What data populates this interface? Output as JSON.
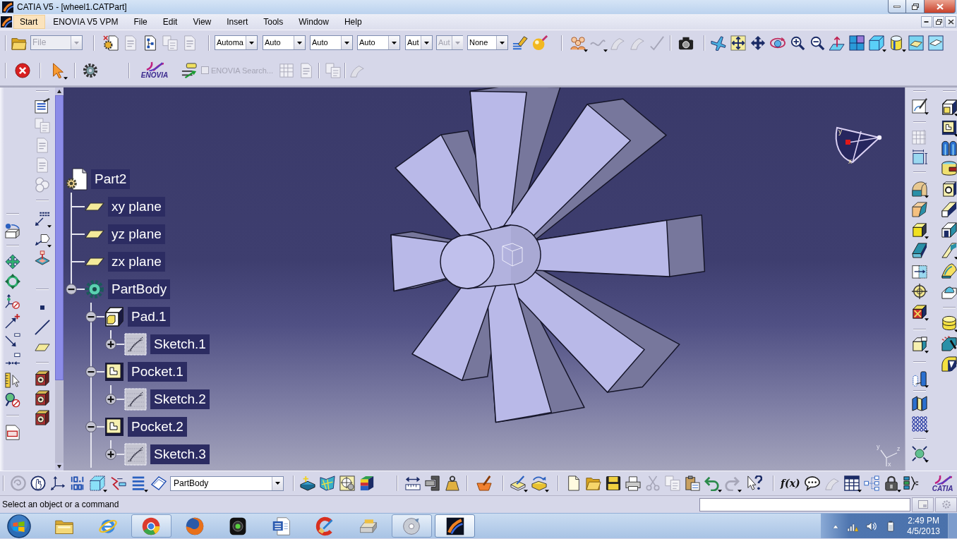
{
  "window": {
    "title": "CATIA V5 - [wheel1.CATPart]"
  },
  "menu_bar": {
    "items": [
      {
        "label": "Start",
        "selected": true
      },
      {
        "label": "ENOVIA V5 VPM",
        "selected": false
      },
      {
        "label": "File",
        "selected": false
      },
      {
        "label": "Edit",
        "selected": false
      },
      {
        "label": "View",
        "selected": false
      },
      {
        "label": "Insert",
        "selected": false
      },
      {
        "label": "Tools",
        "selected": false
      },
      {
        "label": "Window",
        "selected": false
      },
      {
        "label": "Help",
        "selected": false
      }
    ]
  },
  "standard_toolbar": {
    "file_combo": {
      "value": "File",
      "disabled": true
    }
  },
  "graphic_properties": {
    "combos": [
      {
        "value": "Automa",
        "disabled": false
      },
      {
        "value": "Auto",
        "disabled": false
      },
      {
        "value": "Auto",
        "disabled": false
      },
      {
        "value": "Auto",
        "disabled": false
      },
      {
        "value": "Aut",
        "disabled": false
      },
      {
        "value": "Aut",
        "disabled": true
      },
      {
        "value": "None",
        "disabled": false
      }
    ]
  },
  "enovia_toolbar": {
    "logo": "ENOVIA",
    "search": {
      "label": "ENOVIA Search...",
      "checked": false,
      "disabled": true
    }
  },
  "spec_tree": {
    "root": {
      "label": "Part2",
      "kind": "part",
      "children": [
        {
          "label": "xy plane",
          "kind": "plane"
        },
        {
          "label": "yz plane",
          "kind": "plane"
        },
        {
          "label": "zx plane",
          "kind": "plane"
        },
        {
          "label": "PartBody",
          "kind": "body",
          "expanded": true,
          "children": [
            {
              "label": "Pad.1",
              "kind": "pad",
              "expanded": true,
              "children": [
                {
                  "label": "Sketch.1",
                  "kind": "sketch",
                  "expanded": false
                }
              ]
            },
            {
              "label": "Pocket.1",
              "kind": "pocket",
              "expanded": true,
              "children": [
                {
                  "label": "Sketch.2",
                  "kind": "sketch",
                  "expanded": false
                }
              ]
            },
            {
              "label": "Pocket.2",
              "kind": "pocket",
              "expanded": true,
              "children": [
                {
                  "label": "Sketch.3",
                  "kind": "sketch",
                  "expanded": false
                }
              ]
            }
          ]
        }
      ]
    }
  },
  "compass": {
    "labels": [
      "y",
      "x"
    ]
  },
  "axis_triad": {
    "labels": [
      "y",
      "z",
      "x"
    ]
  },
  "tools_toolbar": {
    "part_combo": {
      "value": "PartBody"
    },
    "formula": "f(x)",
    "logo": "CATIA"
  },
  "status_bar": {
    "message": "Select an object or a command"
  },
  "taskbar": {
    "buttons": [
      {
        "kind": "folder",
        "running": false,
        "selected": false
      },
      {
        "kind": "ie",
        "running": false,
        "selected": false
      },
      {
        "kind": "chrome",
        "running": true,
        "selected": false
      },
      {
        "kind": "firefox",
        "running": false,
        "selected": false
      },
      {
        "kind": "webcam",
        "running": false,
        "selected": false
      },
      {
        "kind": "word",
        "running": false,
        "selected": false
      },
      {
        "kind": "cleaner",
        "running": false,
        "selected": false
      },
      {
        "kind": "scanner",
        "running": false,
        "selected": false
      },
      {
        "kind": "disk",
        "running": true,
        "selected": false
      },
      {
        "kind": "catia",
        "running": true,
        "selected": true
      }
    ],
    "time": "2:49 PM",
    "date": "4/5/2013"
  }
}
